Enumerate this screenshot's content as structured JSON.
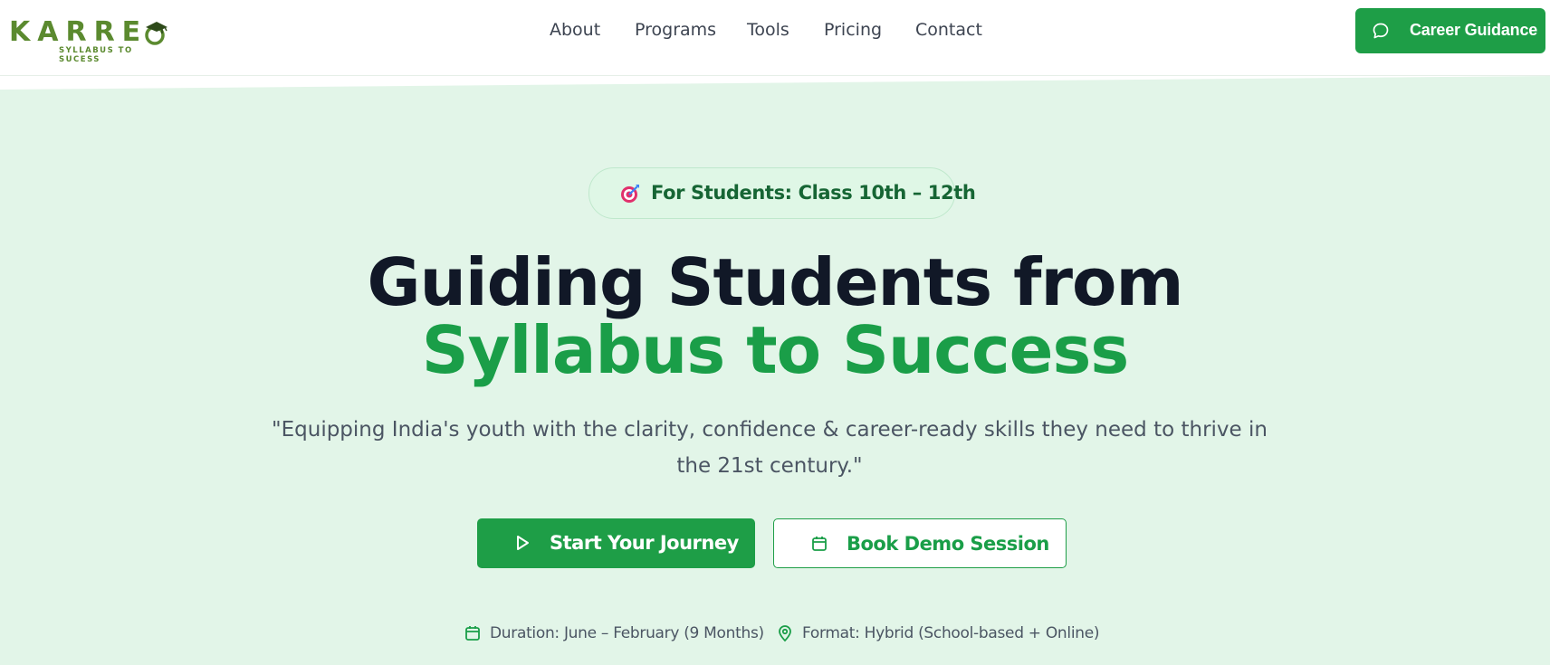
{
  "brand": {
    "name": "KARRE",
    "tagline": "SYLLABUS TO SUCESS"
  },
  "nav": {
    "links": [
      "About",
      "Programs",
      "Tools",
      "Pricing",
      "Contact"
    ],
    "cta": "Career Guidance"
  },
  "hero": {
    "badge": "For Students: Class 10th – 12th",
    "title_line1": "Guiding Students from",
    "title_line2": "Syllabus to Success",
    "quote": "\"Equipping India's youth with the clarity, confidence & career-ready skills they need to thrive in the 21st century.\"",
    "primary_button": "Start Your Journey",
    "secondary_button": "Book Demo Session",
    "duration": "Duration: June – February (9 Months)",
    "format": "Format: Hybrid (School-based + Online)"
  },
  "colors": {
    "brand_green": "#1e9e47",
    "logo_green": "#5b8a2f",
    "hero_bg": "#e2f5e8",
    "heading_dark": "#111827"
  },
  "icons": {
    "cta": "chat-bubble-icon",
    "badge": "target-icon",
    "primary_button": "play-icon",
    "secondary_button": "calendar-icon",
    "duration": "calendar-icon",
    "format": "map-pin-icon"
  }
}
